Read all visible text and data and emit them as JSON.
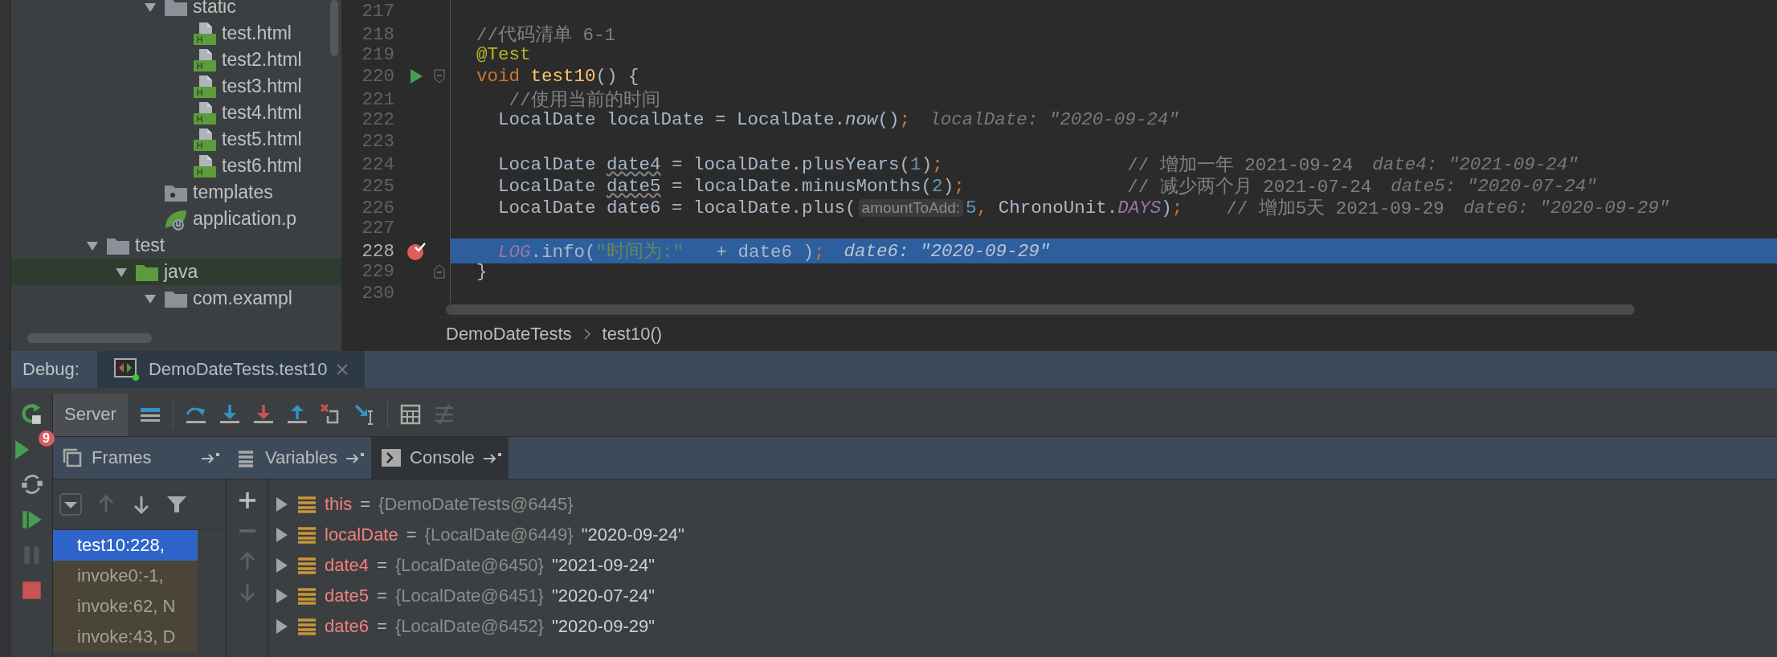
{
  "project_tree": {
    "partial_branch": [
      {
        "label": "static",
        "kind": "folder",
        "expanded": true,
        "selected": false,
        "children": [
          {
            "label": "test.html",
            "kind": "html",
            "selected": false
          },
          {
            "label": "test2.html",
            "kind": "html",
            "selected": false
          },
          {
            "label": "test3.html",
            "kind": "html",
            "selected": false
          },
          {
            "label": "test4.html",
            "kind": "html",
            "selected": false
          },
          {
            "label": "test5.html",
            "kind": "html",
            "selected": false
          },
          {
            "label": "test6.html",
            "kind": "html",
            "selected": false
          }
        ]
      },
      {
        "label": "templates",
        "kind": "templates-folder",
        "selected": false
      },
      {
        "label": "application.p",
        "kind": "config",
        "selected": false
      }
    ],
    "nodes": [
      {
        "label": "test",
        "kind": "folder",
        "expanded": true,
        "selected": false,
        "children": [
          {
            "label": "java",
            "kind": "source-folder",
            "expanded": true,
            "selected": true,
            "children": [
              {
                "label": "com.exampl",
                "kind": "folder",
                "expanded": true,
                "selected": false
              }
            ]
          }
        ]
      }
    ]
  },
  "editor": {
    "lines": [
      {
        "number": "217",
        "current": false,
        "kind": "plain"
      },
      {
        "number": "218",
        "current": false,
        "kind": "plain",
        "tokens": [
          {
            "text": "//代码清单 6-1",
            "kind": "comment"
          }
        ]
      },
      {
        "number": "219",
        "current": false,
        "kind": "plain",
        "tokens": [
          {
            "text": "@Test",
            "kind": "annotation"
          }
        ]
      },
      {
        "number": "220",
        "current": false,
        "kind": "method-start",
        "tokens": [
          {
            "text": "void",
            "kind": "keyword"
          },
          {
            "text": " test10",
            "kind": "method"
          },
          {
            "text": "() {",
            "kind": "plain"
          }
        ]
      },
      {
        "number": "221",
        "current": false,
        "kind": "plain",
        "tokens": [
          {
            "text": "   //使用当前的时间",
            "kind": "comment"
          }
        ]
      },
      {
        "number": "222",
        "current": false,
        "kind": "plain",
        "tokens": [
          {
            "text": "  LocalDate localDate = LocalDate.",
            "kind": "plain"
          },
          {
            "text": "now",
            "kind": "italic"
          },
          {
            "text": "()",
            "kind": "plain"
          },
          {
            "text": ";",
            "kind": "punct"
          },
          {
            "text": "localDate: \"2020-09-24\"",
            "kind": "value-hint"
          }
        ]
      },
      {
        "number": "223",
        "current": false,
        "kind": "plain"
      },
      {
        "number": "224",
        "current": false,
        "kind": "plain",
        "tokens": [
          {
            "text": "  LocalDate ",
            "kind": "plain"
          },
          {
            "text": "date4",
            "kind": "warn"
          },
          {
            "text": " = localDate.plusYears(",
            "kind": "plain"
          },
          {
            "text": "1",
            "kind": "number"
          },
          {
            "text": ")",
            "kind": "plain"
          },
          {
            "text": ";",
            "kind": "punct"
          },
          {
            "text": "                 // 增加一年 2021-09-24",
            "kind": "comment"
          },
          {
            "text": "date4: \"2021-09-24\"",
            "kind": "value-hint"
          }
        ]
      },
      {
        "number": "225",
        "current": false,
        "kind": "plain",
        "tokens": [
          {
            "text": "  LocalDate ",
            "kind": "plain"
          },
          {
            "text": "date5",
            "kind": "warn"
          },
          {
            "text": " = localDate.minusMonths(",
            "kind": "plain"
          },
          {
            "text": "2",
            "kind": "number"
          },
          {
            "text": ")",
            "kind": "plain"
          },
          {
            "text": ";",
            "kind": "punct"
          },
          {
            "text": "               // 减少两个月 2021-07-24",
            "kind": "comment"
          },
          {
            "text": "date5: \"2020-07-24\"",
            "kind": "value-hint"
          }
        ]
      },
      {
        "number": "226",
        "current": false,
        "kind": "plain",
        "tokens": [
          {
            "text": "  LocalDate date6 = localDate.plus(",
            "kind": "plain"
          },
          {
            "text": "amountToAdd:",
            "kind": "param-hint"
          },
          {
            "text": "5",
            "kind": "number"
          },
          {
            "text": ",",
            "kind": "punct"
          },
          {
            "text": " ChronoUnit.",
            "kind": "plain"
          },
          {
            "text": "DAYS",
            "kind": "constant"
          },
          {
            "text": ")",
            "kind": "plain"
          },
          {
            "text": ";",
            "kind": "punct"
          },
          {
            "text": "    // 增加5天 2021-09-29",
            "kind": "comment"
          },
          {
            "text": "date6: \"2020-09-29\"",
            "kind": "value-hint"
          }
        ]
      },
      {
        "number": "227",
        "current": false,
        "kind": "plain"
      },
      {
        "number": "228",
        "current": true,
        "kind": "breakpoint",
        "tokens": [
          {
            "text": "  LOG",
            "kind": "constant"
          },
          {
            "text": ".info(",
            "kind": "plain"
          },
          {
            "text": "\"时间为:\"",
            "kind": "string"
          },
          {
            "text": "   + date6 )",
            "kind": "plain"
          },
          {
            "text": ";",
            "kind": "punct"
          },
          {
            "text": "date6: \"2020-09-29\"",
            "kind": "value-hint"
          }
        ]
      },
      {
        "number": "229",
        "current": false,
        "kind": "block-end",
        "tokens": [
          {
            "text": "}",
            "kind": "plain"
          }
        ]
      },
      {
        "number": "230",
        "current": false,
        "kind": "plain"
      }
    ],
    "breadcrumb": [
      "DemoDateTests",
      "test10()"
    ]
  },
  "debug": {
    "label": "Debug:",
    "tabs": [
      {
        "label": "DemoDateTests.test10",
        "selected": true
      }
    ],
    "side_tools": [
      {
        "kind": "rerun",
        "disabled": false
      },
      {
        "kind": "breakpoints",
        "badge": "9",
        "disabled": false
      },
      {
        "kind": "restore",
        "disabled": false
      },
      {
        "kind": "resume",
        "disabled": false
      },
      {
        "kind": "pause",
        "disabled": true
      },
      {
        "kind": "stop",
        "disabled": false
      }
    ],
    "toolbar_tabs": [
      {
        "label": "Server",
        "selected": true
      }
    ],
    "toolbar": [
      {
        "kind": "frames",
        "disabled": false
      },
      {
        "kind": "sep"
      },
      {
        "kind": "step-over",
        "disabled": false
      },
      {
        "kind": "step-into",
        "disabled": false
      },
      {
        "kind": "force-step-into",
        "disabled": false
      },
      {
        "kind": "step-out",
        "disabled": false
      },
      {
        "kind": "drop-frame",
        "disabled": false
      },
      {
        "kind": "run-to-cursor",
        "disabled": false
      },
      {
        "kind": "sep"
      },
      {
        "kind": "evaluate",
        "disabled": false
      },
      {
        "kind": "trace",
        "disabled": true
      }
    ],
    "panel_tabs": [
      {
        "label": "Frames",
        "kind": "frames",
        "selected": false
      },
      {
        "label": "Variables",
        "kind": "list",
        "selected": false
      },
      {
        "label": "Console",
        "kind": "console",
        "selected": true
      }
    ],
    "frame_tools": [
      {
        "kind": "dropdown",
        "disabled": false
      },
      {
        "kind": "up",
        "disabled": true
      },
      {
        "kind": "down",
        "disabled": false
      },
      {
        "kind": "filter",
        "disabled": false
      }
    ],
    "frames": [
      {
        "label": "test10:228,",
        "selected": true
      },
      {
        "label": "invoke0:-1,",
        "selected": false
      },
      {
        "label": "invoke:62, N",
        "selected": false
      },
      {
        "label": "invoke:43, D",
        "selected": false
      }
    ],
    "watch_tools": [
      {
        "kind": "add",
        "disabled": false
      },
      {
        "kind": "remove",
        "disabled": true
      },
      {
        "kind": "up",
        "disabled": true
      },
      {
        "kind": "down",
        "disabled": true
      }
    ],
    "variables": [
      {
        "name": "this",
        "separator": "=",
        "ref": "{DemoDateTests@6445}"
      },
      {
        "name": "localDate",
        "separator": "=",
        "ref": "{LocalDate@6449}",
        "value": "\"2020-09-24\""
      },
      {
        "name": "date4",
        "separator": "=",
        "ref": "{LocalDate@6450}",
        "value": "\"2021-09-24\""
      },
      {
        "name": "date5",
        "separator": "=",
        "ref": "{LocalDate@6451}",
        "value": "\"2020-07-24\""
      },
      {
        "name": "date6",
        "separator": "=",
        "ref": "{LocalDate@6452}",
        "value": "\"2020-09-29\""
      }
    ]
  }
}
